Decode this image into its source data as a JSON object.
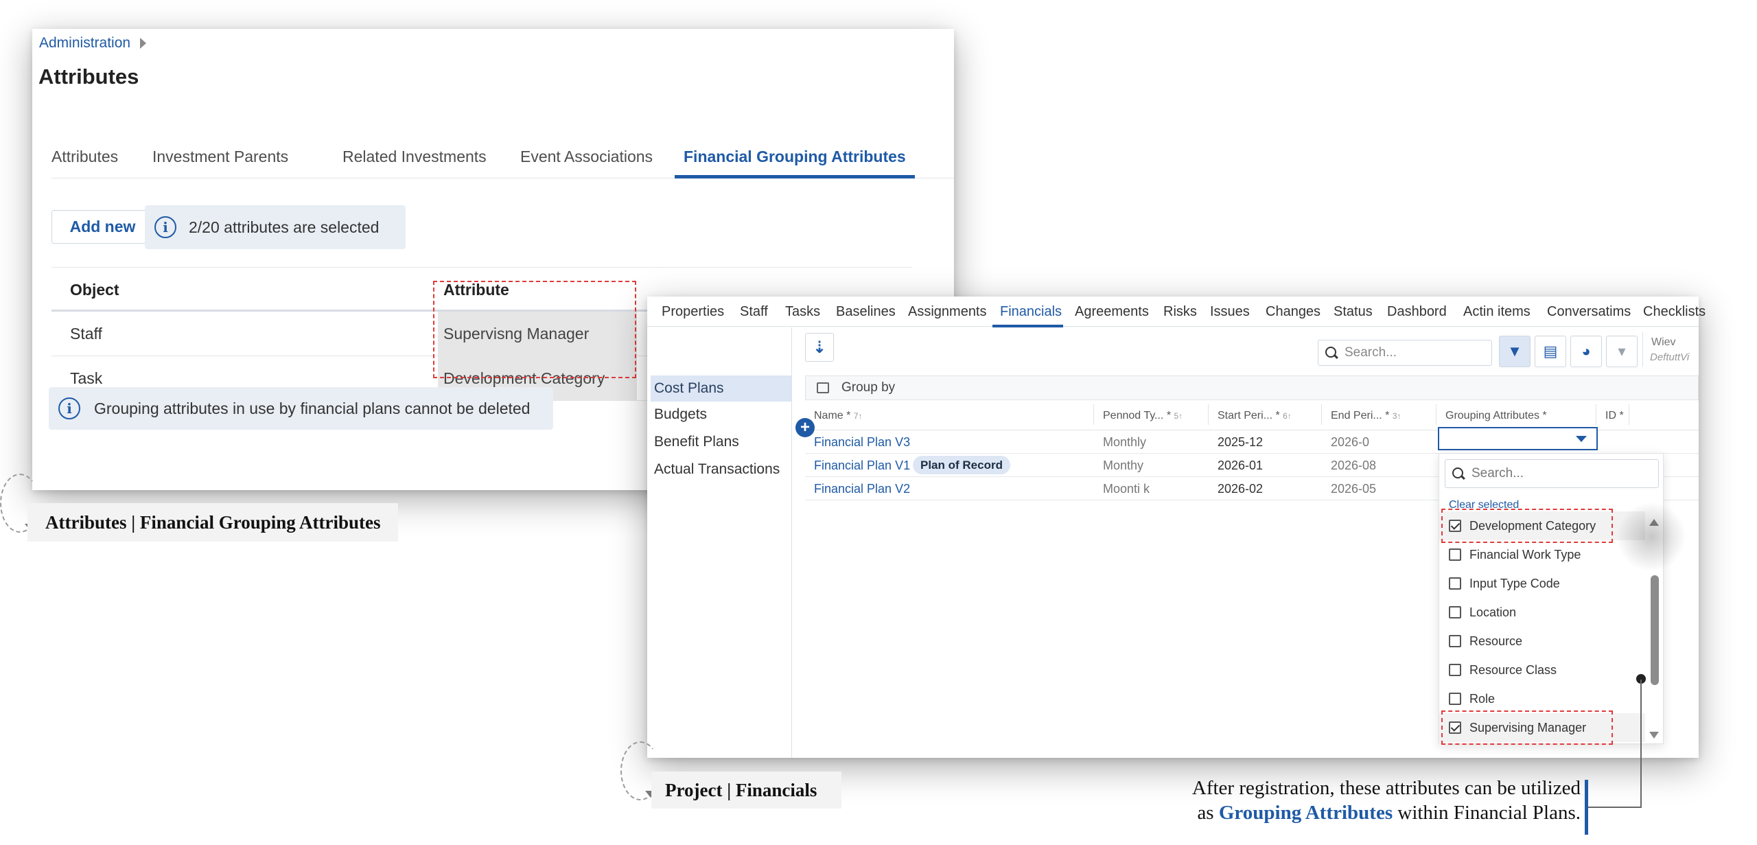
{
  "admin": {
    "breadcrumb": "Administration",
    "title": "Attributes",
    "tabs": [
      "Attributes",
      "Investment Parents",
      "Related Investments",
      "Event Associations",
      "Financial Grouping Attributes"
    ],
    "active_tab": "Financial Grouping Attributes",
    "add_new_label": "Add new",
    "selected_info": "2/20 attributes are selected",
    "table": {
      "headers": [
        "Object",
        "Attribute"
      ],
      "rows": [
        {
          "object": "Staff",
          "attribute": "Supervisng Manager"
        },
        {
          "object": "Task",
          "attribute": "Development Category"
        }
      ]
    },
    "warning": "Grouping attributes in use by financial plans cannot be deleted",
    "caption": "Attributes | Financial Grouping Attributes"
  },
  "project": {
    "tabs": [
      "Properties",
      "Staff",
      "Tasks",
      "Baselines",
      "Assignments",
      "Financials",
      "Agreements",
      "Risks",
      "Issues",
      "Changes",
      "Status",
      "Dashbord",
      "Actin items",
      "Conversatims",
      "Checklists"
    ],
    "active_tab": "Financials",
    "sidebar": [
      "Cost Plans",
      "Budgets",
      "Benefit Plans",
      "Actual Transactions"
    ],
    "active_side": "Cost Plans",
    "search_placeholder": "Search...",
    "view_label": "Wiev",
    "view_value": "DeftuttVi",
    "group_by_label": "Group by",
    "columns": [
      {
        "label": "Name",
        "star": "*",
        "sort": "7↑"
      },
      {
        "label": "Pennod Ty...",
        "star": "*",
        "sort": "5↑"
      },
      {
        "label": "Start Peri...",
        "star": "*",
        "sort": "6↑"
      },
      {
        "label": "End Peri...",
        "star": "*",
        "sort": "3↑"
      },
      {
        "label": "Grouping Attributes",
        "star": "*",
        "sort": ""
      },
      {
        "label": "ID",
        "star": "*",
        "sort": ""
      }
    ],
    "rows": [
      {
        "name": "Financial Plan V3",
        "period": "Monthly",
        "start": "2025-12",
        "end": "2026-0",
        "badge": ""
      },
      {
        "name": "Financial Plan V1",
        "period": "Monthy",
        "start": "2026-01",
        "end": "2026-08",
        "badge": "Plan of Record"
      },
      {
        "name": "Financial Plan V2",
        "period": "Moonti k",
        "start": "2026-02",
        "end": "2026-05",
        "badge": ""
      }
    ],
    "dropdown": {
      "search_placeholder": "Search...",
      "clear_label": "Clear selected",
      "options": [
        {
          "label": "Development Category",
          "checked": true
        },
        {
          "label": "Financial Work Type",
          "checked": false
        },
        {
          "label": "Input Type Code",
          "checked": false
        },
        {
          "label": "Location",
          "checked": false
        },
        {
          "label": "Resource",
          "checked": false
        },
        {
          "label": "Resource Class",
          "checked": false
        },
        {
          "label": "Role",
          "checked": false
        },
        {
          "label": "Supervising Manager",
          "checked": true
        }
      ]
    },
    "caption": "Project | Financials"
  },
  "note": {
    "line1": "After registration, these attributes can be utilized",
    "line2_prefix": "as",
    "line2_highlight": "Grouping Attributes",
    "line2_suffix": "within Financial Plans."
  },
  "colors": {
    "accent": "#1f5aa6",
    "highlight_border": "#e03a3a",
    "selected_bg": "#dce6f4"
  }
}
